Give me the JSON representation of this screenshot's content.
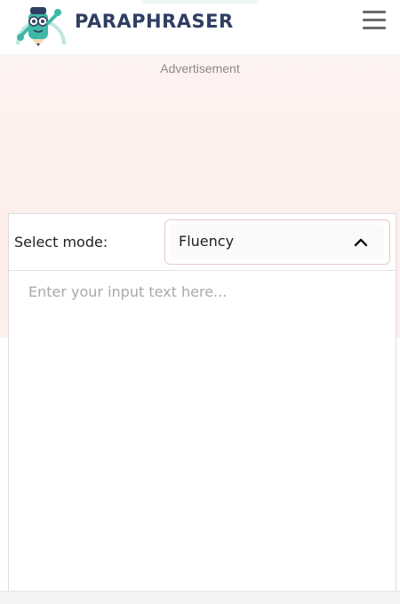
{
  "header": {
    "brand": "PARAPHRASER",
    "logo_icon": "pencil-mascot-icon",
    "menu_icon": "hamburger-menu-icon"
  },
  "ad": {
    "label": "Advertisement"
  },
  "mode": {
    "label": "Select mode:",
    "selected": "Fluency",
    "chevron_icon": "chevron-up-icon"
  },
  "input": {
    "placeholder": "Enter your input text here..."
  },
  "colors": {
    "brand_text": "#2f3e63",
    "mascot_teal": "#3fb7a6",
    "ad_background": "#fdeeea"
  }
}
